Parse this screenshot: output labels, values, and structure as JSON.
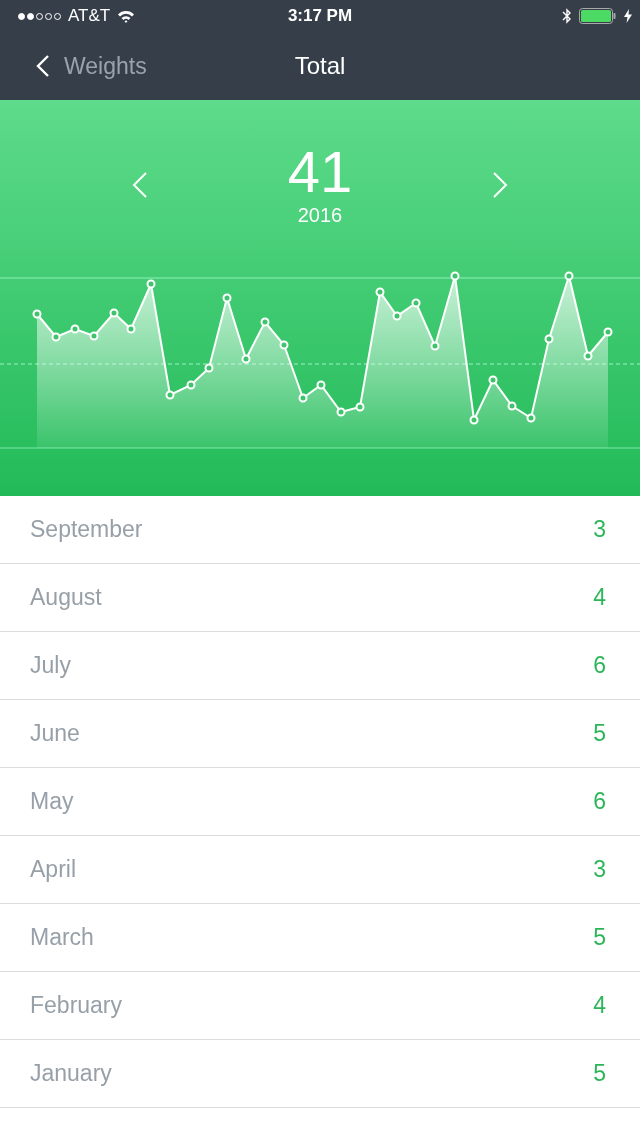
{
  "status_bar": {
    "carrier": "AT&T",
    "time": "3:17 PM"
  },
  "nav": {
    "back_label": "Weights",
    "title": "Total"
  },
  "summary": {
    "value": "41",
    "year": "2016"
  },
  "months": [
    {
      "name": "September",
      "count": "3"
    },
    {
      "name": "August",
      "count": "4"
    },
    {
      "name": "July",
      "count": "6"
    },
    {
      "name": "June",
      "count": "5"
    },
    {
      "name": "May",
      "count": "6"
    },
    {
      "name": "April",
      "count": "3"
    },
    {
      "name": "March",
      "count": "5"
    },
    {
      "name": "February",
      "count": "4"
    },
    {
      "name": "January",
      "count": "5"
    }
  ]
}
